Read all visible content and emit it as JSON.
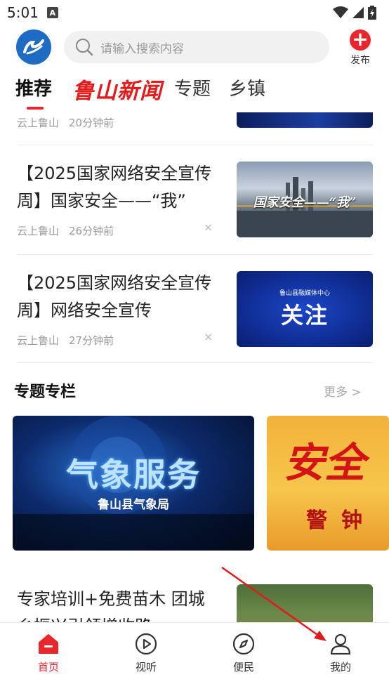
{
  "status_bar": {
    "time": "5:01",
    "badge": "A"
  },
  "header": {
    "search_placeholder": "请输入搜索内容",
    "publish_label": "发布",
    "accent_color": "#e8262b",
    "logo_color": "#1e6bc4"
  },
  "tabs": [
    {
      "label": "推荐",
      "active": true
    },
    {
      "label": "鲁山新闻",
      "active": false
    },
    {
      "label": "专题",
      "active": false
    },
    {
      "label": "乡镇",
      "active": false
    }
  ],
  "feed": {
    "partial_item": {
      "source": "云上鲁山",
      "time": "20分钟前"
    },
    "items": [
      {
        "title": "【2025国家网络安全宣传周】国家安全——“我”",
        "source": "云上鲁山",
        "time": "26分钟前",
        "thumb_text": "国家安全——“我”"
      },
      {
        "title": "【2025国家网络安全宣传周】网络安全宣传",
        "source": "云上鲁山",
        "time": "27分钟前",
        "thumb_small": "鲁山县融媒体中心",
        "thumb_text": "关注"
      }
    ],
    "close_icon": "×"
  },
  "special_section": {
    "title": "专题专栏",
    "more_label": "更多 >",
    "cards": [
      {
        "title": "气象服务",
        "subtitle": "鲁山县气象局"
      },
      {
        "title": "安全",
        "subtitle": "警钟"
      }
    ]
  },
  "bottom_item": {
    "title": "专家培训+免费苗木 团城乡振兴引领增收路"
  },
  "bottom_nav": [
    {
      "label": "首页",
      "icon": "home-icon",
      "active": true
    },
    {
      "label": "视听",
      "icon": "play-icon",
      "active": false
    },
    {
      "label": "便民",
      "icon": "compass-icon",
      "active": false
    },
    {
      "label": "我的",
      "icon": "user-icon",
      "active": false
    }
  ]
}
